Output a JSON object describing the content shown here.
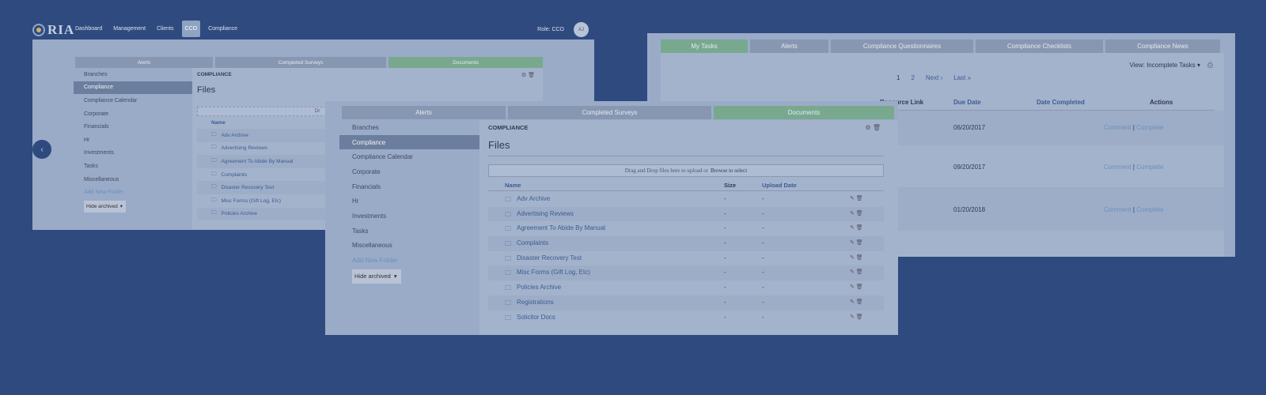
{
  "window1": {
    "logo_text": "RIA",
    "nav": [
      "Dashboard",
      "Management",
      "Clients",
      "CCO",
      "Compliance"
    ],
    "nav_active": "CCO",
    "role": "Role: CCO",
    "avatar": "AJ",
    "tabs": [
      "Alerts",
      "Completed Surveys",
      "Documents"
    ],
    "sidebar": [
      "Branches",
      "Compliance",
      "Compliance Calendar",
      "Corporate",
      "Financials",
      "Hr",
      "Investments",
      "Tasks",
      "Miscellaneous"
    ],
    "add_folder": "Add New Folder",
    "hide_archived": "Hide archived",
    "section": "COMPLIANCE",
    "title": "Files",
    "drop_hint": "Dr",
    "column_name": "Name",
    "files": [
      "Adv Archive",
      "Advertising Reviews",
      "Agreement To Abide By Manual",
      "Complaints",
      "Disaster Recovery Test",
      "Misc Forms (Gift Log, Etc)",
      "Policies Archive"
    ]
  },
  "window2": {
    "tabs": [
      "Alerts",
      "Completed Surveys",
      "Documents"
    ],
    "sidebar": [
      "Branches",
      "Compliance",
      "Compliance Calendar",
      "Corporate",
      "Financials",
      "Hr",
      "Investments",
      "Tasks",
      "Miscellaneous"
    ],
    "add_folder": "Add New Folder",
    "hide_archived": "Hide archived",
    "section": "COMPLIANCE",
    "title": "Files",
    "drop_text": "Drag and Drop files here to upload or",
    "drop_link": "Browse to select",
    "columns": {
      "name": "Name",
      "size": "Size",
      "upload_date": "Upload Date"
    },
    "files": [
      {
        "name": "Adv Archive",
        "size": "-",
        "date": "-"
      },
      {
        "name": "Advertising Reviews",
        "size": "-",
        "date": "-"
      },
      {
        "name": "Agreement To Abide By Manual",
        "size": "-",
        "date": "-"
      },
      {
        "name": "Complaints",
        "size": "-",
        "date": "-"
      },
      {
        "name": "Disaster Recovery Test",
        "size": "-",
        "date": "-"
      },
      {
        "name": "Misc Forms (Gift Log, Etc)",
        "size": "-",
        "date": "-"
      },
      {
        "name": "Policies Archive",
        "size": "-",
        "date": "-"
      },
      {
        "name": "Registrations",
        "size": "-",
        "date": "-"
      },
      {
        "name": "Solicitor Docs",
        "size": "-",
        "date": "-"
      }
    ]
  },
  "window3": {
    "tabs": [
      "My Tasks",
      "Alerts",
      "Compliance Questionnaires",
      "Compliance Checklists",
      "Compliance News"
    ],
    "view_label": "View: Incomplete Tasks",
    "pager": [
      "1",
      "2",
      "Next ›",
      "Last »"
    ],
    "columns": {
      "resource": "Resource Link",
      "due": "Due Date",
      "completed": "Date Completed",
      "actions": "Actions"
    },
    "tasks": [
      {
        "due": "06/20/2017",
        "comment": "Comment",
        "complete": "Complete"
      },
      {
        "due": "09/20/2017",
        "comment": "Comment",
        "complete": "Complete"
      },
      {
        "due": "01/20/2018",
        "comment": "Comment",
        "complete": "Complete"
      }
    ]
  },
  "colors": {
    "background": "#2f4a7f",
    "active_tab": "#78a98f",
    "active_sidebar": "#6c7e9d",
    "link": "#3b5c90"
  },
  "icons": [
    "chevron-left-icon",
    "gear-icon",
    "trash-icon",
    "pencil-icon",
    "folder-icon",
    "print-icon",
    "caret-down-icon"
  ]
}
